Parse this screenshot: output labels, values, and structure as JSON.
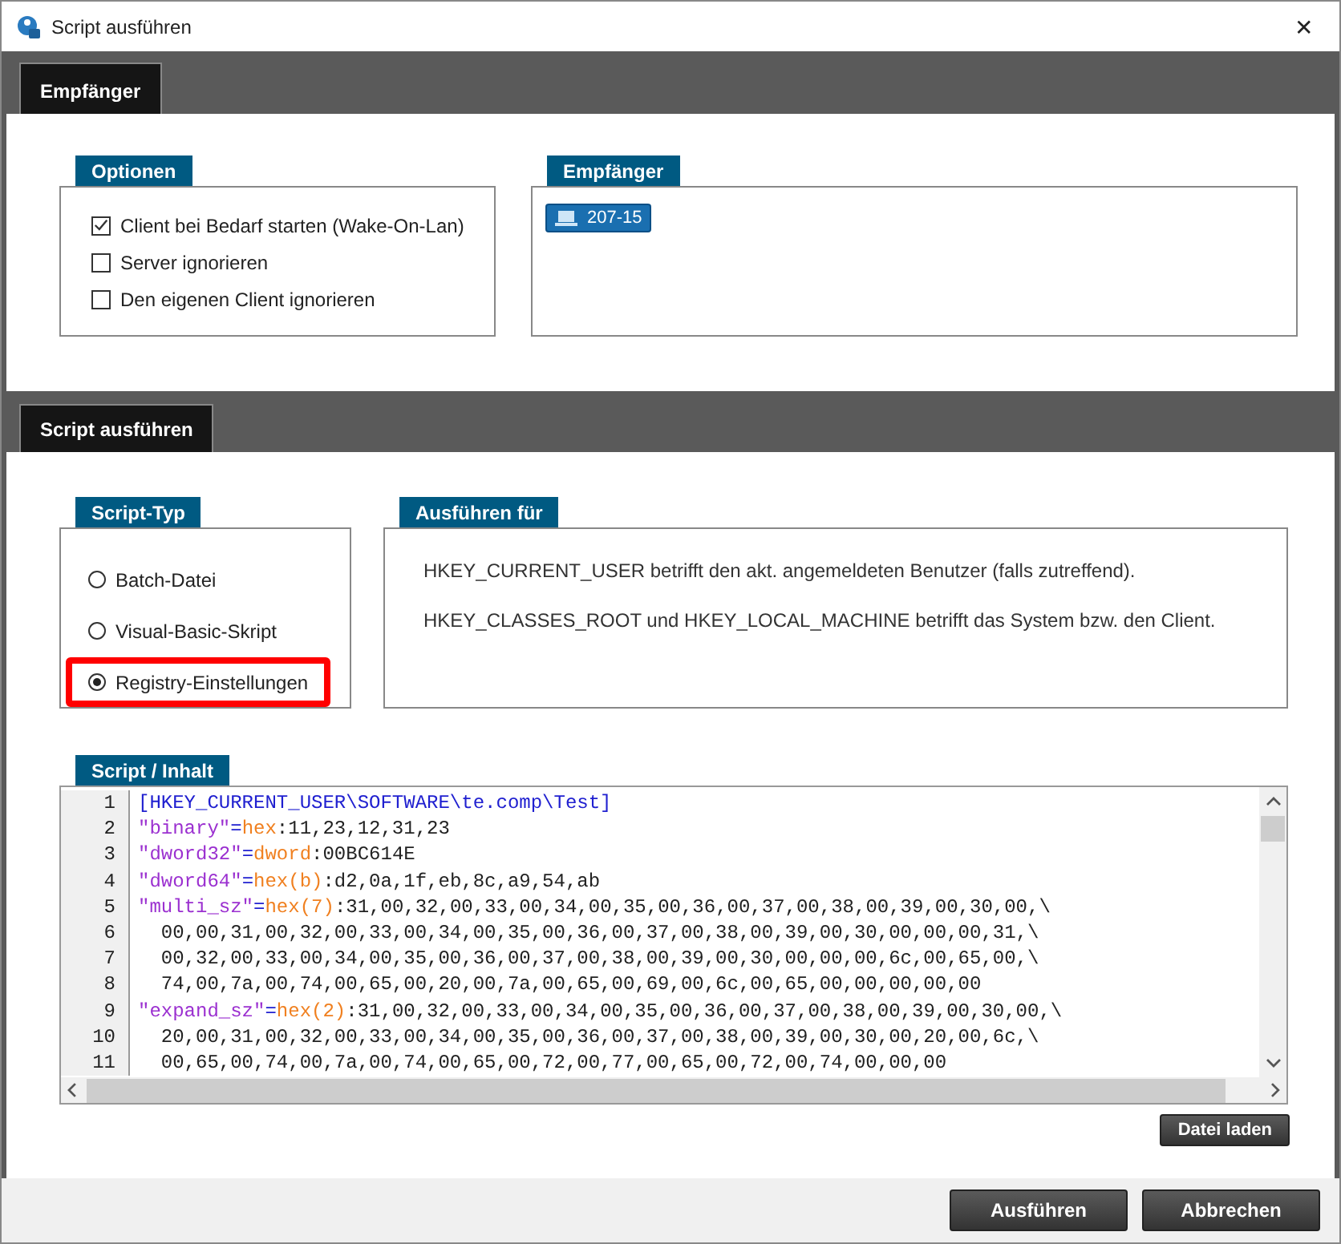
{
  "window": {
    "title": "Script ausführen",
    "close": "✕"
  },
  "recipients_section": {
    "tab": "Empfänger",
    "options": {
      "title": "Optionen",
      "items": [
        {
          "label": "Client bei Bedarf starten (Wake-On-Lan)",
          "checked": true
        },
        {
          "label": "Server ignorieren",
          "checked": false
        },
        {
          "label": "Den eigenen Client ignorieren",
          "checked": false
        }
      ]
    },
    "recipients": {
      "title": "Empfänger",
      "items": [
        "207-15"
      ]
    }
  },
  "script_section": {
    "tab": "Script ausführen",
    "script_type": {
      "title": "Script-Typ",
      "items": [
        {
          "label": "Batch-Datei",
          "selected": false,
          "highlighted": false
        },
        {
          "label": "Visual-Basic-Skript",
          "selected": false,
          "highlighted": false
        },
        {
          "label": "Registry-Einstellungen",
          "selected": true,
          "highlighted": true
        }
      ]
    },
    "execute_for": {
      "title": "Ausführen für",
      "lines": [
        "HKEY_CURRENT_USER betrifft den akt. angemeldeten Benutzer (falls zutreffend).",
        "HKEY_CLASSES_ROOT und HKEY_LOCAL_MACHINE betrifft das System bzw. den Client."
      ]
    },
    "content": {
      "title": "Script / Inhalt",
      "lines": [
        {
          "number": "1",
          "segments": [
            {
              "kind": "section",
              "text": "[HKEY_CURRENT_USER\\SOFTWARE\\te.comp\\Test]"
            }
          ]
        },
        {
          "number": "2",
          "segments": [
            {
              "kind": "key",
              "text": "\"binary\""
            },
            {
              "kind": "op",
              "text": "="
            },
            {
              "kind": "type",
              "text": "hex"
            },
            {
              "kind": "data",
              "text": ":11,23,12,31,23"
            }
          ]
        },
        {
          "number": "3",
          "segments": [
            {
              "kind": "key",
              "text": "\"dword32\""
            },
            {
              "kind": "op",
              "text": "="
            },
            {
              "kind": "type",
              "text": "dword"
            },
            {
              "kind": "data",
              "text": ":00BC614E"
            }
          ]
        },
        {
          "number": "4",
          "segments": [
            {
              "kind": "key",
              "text": "\"dword64\""
            },
            {
              "kind": "op",
              "text": "="
            },
            {
              "kind": "type",
              "text": "hex(b)"
            },
            {
              "kind": "data",
              "text": ":d2,0a,1f,eb,8c,a9,54,ab"
            }
          ]
        },
        {
          "number": "5",
          "segments": [
            {
              "kind": "key",
              "text": "\"multi_sz\""
            },
            {
              "kind": "op",
              "text": "="
            },
            {
              "kind": "type",
              "text": "hex(7)"
            },
            {
              "kind": "data",
              "text": ":31,00,32,00,33,00,34,00,35,00,36,00,37,00,38,00,39,00,30,00,\\"
            }
          ]
        },
        {
          "number": "6",
          "segments": [
            {
              "kind": "data",
              "text": "  00,00,31,00,32,00,33,00,34,00,35,00,36,00,37,00,38,00,39,00,30,00,00,00,31,\\"
            }
          ]
        },
        {
          "number": "7",
          "segments": [
            {
              "kind": "data",
              "text": "  00,32,00,33,00,34,00,35,00,36,00,37,00,38,00,39,00,30,00,00,00,6c,00,65,00,\\"
            }
          ]
        },
        {
          "number": "8",
          "segments": [
            {
              "kind": "data",
              "text": "  74,00,7a,00,74,00,65,00,20,00,7a,00,65,00,69,00,6c,00,65,00,00,00,00,00"
            }
          ]
        },
        {
          "number": "9",
          "segments": [
            {
              "kind": "key",
              "text": "\"expand_sz\""
            },
            {
              "kind": "op",
              "text": "="
            },
            {
              "kind": "type",
              "text": "hex(2)"
            },
            {
              "kind": "data",
              "text": ":31,00,32,00,33,00,34,00,35,00,36,00,37,00,38,00,39,00,30,00,\\"
            }
          ]
        },
        {
          "number": "10",
          "segments": [
            {
              "kind": "data",
              "text": "  20,00,31,00,32,00,33,00,34,00,35,00,36,00,37,00,38,00,39,00,30,00,20,00,6c,\\"
            }
          ]
        },
        {
          "number": "11",
          "segments": [
            {
              "kind": "data",
              "text": "  00,65,00,74,00,7a,00,74,00,65,00,72,00,77,00,65,00,72,00,74,00,00,00"
            }
          ]
        }
      ]
    },
    "load_button": "Datei laden"
  },
  "buttons": [
    "Ausführen",
    "Abbrechen"
  ]
}
